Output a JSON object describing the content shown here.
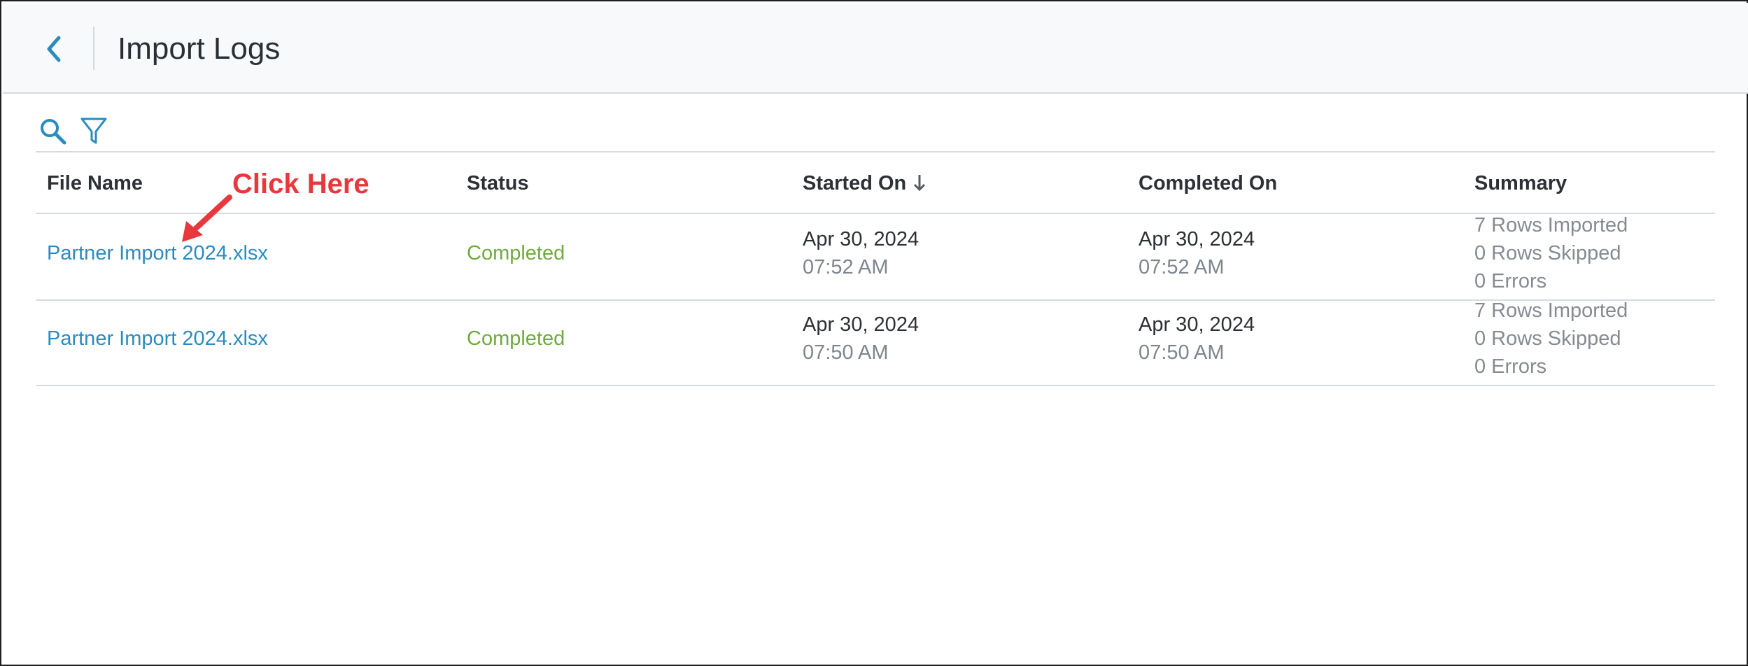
{
  "header": {
    "title": "Import Logs",
    "back_icon": "chevron-left-icon"
  },
  "toolbar": {
    "search_icon": "search-icon",
    "filter_icon": "filter-icon"
  },
  "table": {
    "columns": [
      "File Name",
      "Status",
      "Started On",
      "Completed On",
      "Summary"
    ],
    "sort": {
      "column": "Started On",
      "direction": "descending"
    },
    "rows": [
      {
        "file_name": "Partner Import 2024.xlsx",
        "status": "Completed",
        "started_date": "Apr 30, 2024",
        "started_time": "07:52 AM",
        "completed_date": "Apr 30, 2024",
        "completed_time": "07:52 AM",
        "summary": [
          "7 Rows Imported",
          "0 Rows Skipped",
          "0 Errors"
        ]
      },
      {
        "file_name": "Partner Import 2024.xlsx",
        "status": "Completed",
        "started_date": "Apr 30, 2024",
        "started_time": "07:50 AM",
        "completed_date": "Apr 30, 2024",
        "completed_time": "07:50 AM",
        "summary": [
          "7 Rows Imported",
          "0 Rows Skipped",
          "0 Errors"
        ]
      }
    ]
  },
  "annotation": {
    "text": "Click Here",
    "color": "#e8383d"
  },
  "colors": {
    "accent": "#2b8bbf",
    "status_completed": "#6eab3a",
    "header_bg": "#f7f9fb"
  }
}
